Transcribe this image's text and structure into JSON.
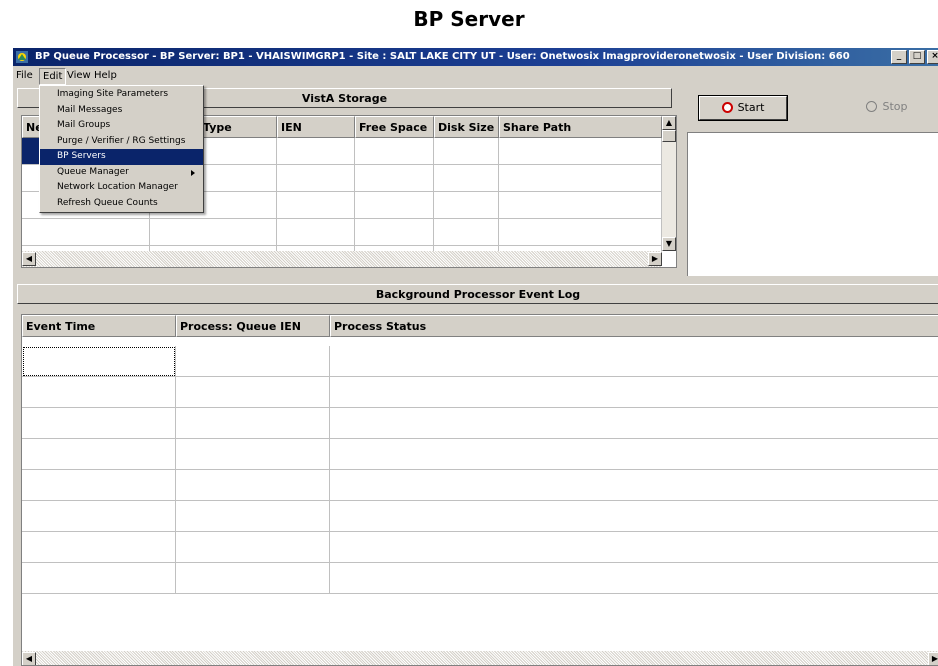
{
  "page_heading": "BP Server",
  "window": {
    "title": "BP Queue Processor   -  BP Server: BP1 - VHAISWIMGRP1   - Site : SALT LAKE CITY UT   -   User: Onetwosix Imagprovideronetwosix   -   User Division: 660",
    "controls": {
      "minimize": "_",
      "maximize": "□",
      "close": "×"
    }
  },
  "menubar": {
    "items": [
      {
        "label": "File"
      },
      {
        "label": "Edit"
      },
      {
        "label": "View"
      },
      {
        "label": "Help"
      }
    ]
  },
  "edit_menu": {
    "items": [
      {
        "label": "Imaging Site Parameters"
      },
      {
        "label": "Mail Messages"
      },
      {
        "label": "Mail Groups"
      },
      {
        "label": "Purge / Verifier / RG Settings"
      },
      {
        "label": "BP Servers",
        "highlighted": true
      },
      {
        "label": "Queue Manager",
        "submenu": true
      },
      {
        "label": "Network Location Manager"
      },
      {
        "label": "Refresh Queue Counts"
      }
    ]
  },
  "storage_panel": {
    "title": "VistA Storage",
    "columns": [
      {
        "label": "Ne"
      },
      {
        "label": "Type"
      },
      {
        "label": "IEN"
      },
      {
        "label": "Free Space"
      },
      {
        "label": "Disk Size"
      },
      {
        "label": "Share Path"
      }
    ]
  },
  "controls": {
    "start_label": "Start",
    "stop_label": "Stop",
    "start_icon": "red-circle-icon",
    "stop_icon": "stop-circle-icon"
  },
  "event_log": {
    "title": "Background Processor Event Log",
    "columns": [
      {
        "label": "Event Time"
      },
      {
        "label": "Process: Queue IEN"
      },
      {
        "label": "Process Status"
      }
    ]
  },
  "colors": {
    "titlebar": "#0a246a",
    "selection": "#0a246a",
    "face": "#d4d0c8",
    "start_icon": "#cc0000"
  }
}
